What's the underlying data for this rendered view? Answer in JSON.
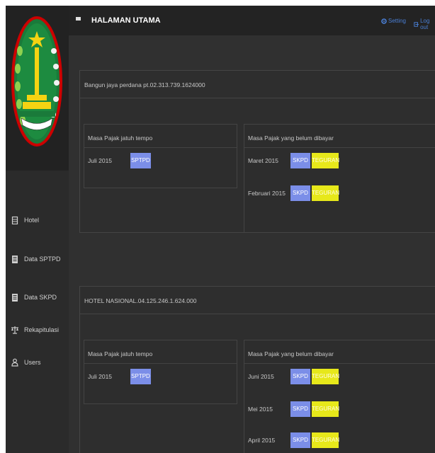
{
  "header": {
    "title": "HALAMAN UTAMA",
    "setting_label": "Setting",
    "logout_label": "Log out"
  },
  "sidebar": {
    "items": [
      {
        "label": "Hotel",
        "icon": "building-icon"
      },
      {
        "label": "Data SPTPD",
        "icon": "document-icon"
      },
      {
        "label": "Data SKPD",
        "icon": "document-icon"
      },
      {
        "label": "Rekapitulasi",
        "icon": "scale-icon"
      },
      {
        "label": "Users",
        "icon": "user-icon"
      }
    ]
  },
  "panels": [
    {
      "title": "Bangun jaya perdana pt.02.313.739.1624000",
      "due": {
        "heading": "Masa Pajak jatuh tempo",
        "rows": [
          {
            "period": "Juli 2015",
            "button": "SPTPD"
          }
        ]
      },
      "unpaid": {
        "heading": "Masa Pajak yang belum dibayar",
        "rows": [
          {
            "period": "Maret 2015",
            "skpd": "SKPD",
            "teguran": "TEGURAN"
          },
          {
            "period": "Februari 2015",
            "skpd": "SKPD",
            "teguran": "TEGURAN"
          }
        ]
      }
    },
    {
      "title": "HOTEL NASIONAL.04.125.246.1.624.000",
      "due": {
        "heading": "Masa Pajak jatuh tempo",
        "rows": [
          {
            "period": "Juli 2015",
            "button": "SPTPD"
          }
        ]
      },
      "unpaid": {
        "heading": "Masa Pajak yang belum dibayar",
        "rows": [
          {
            "period": "Juni 2015",
            "skpd": "SKPD",
            "teguran": "TEGURAN"
          },
          {
            "period": "Mei 2015",
            "skpd": "SKPD",
            "teguran": "TEGURAN"
          },
          {
            "period": "April 2015",
            "skpd": "SKPD",
            "teguran": "TEGURAN"
          }
        ]
      }
    }
  ],
  "colors": {
    "primary_button": "#7b8ee8",
    "warning_button": "#e7e81a",
    "link": "#4a7fd6"
  }
}
